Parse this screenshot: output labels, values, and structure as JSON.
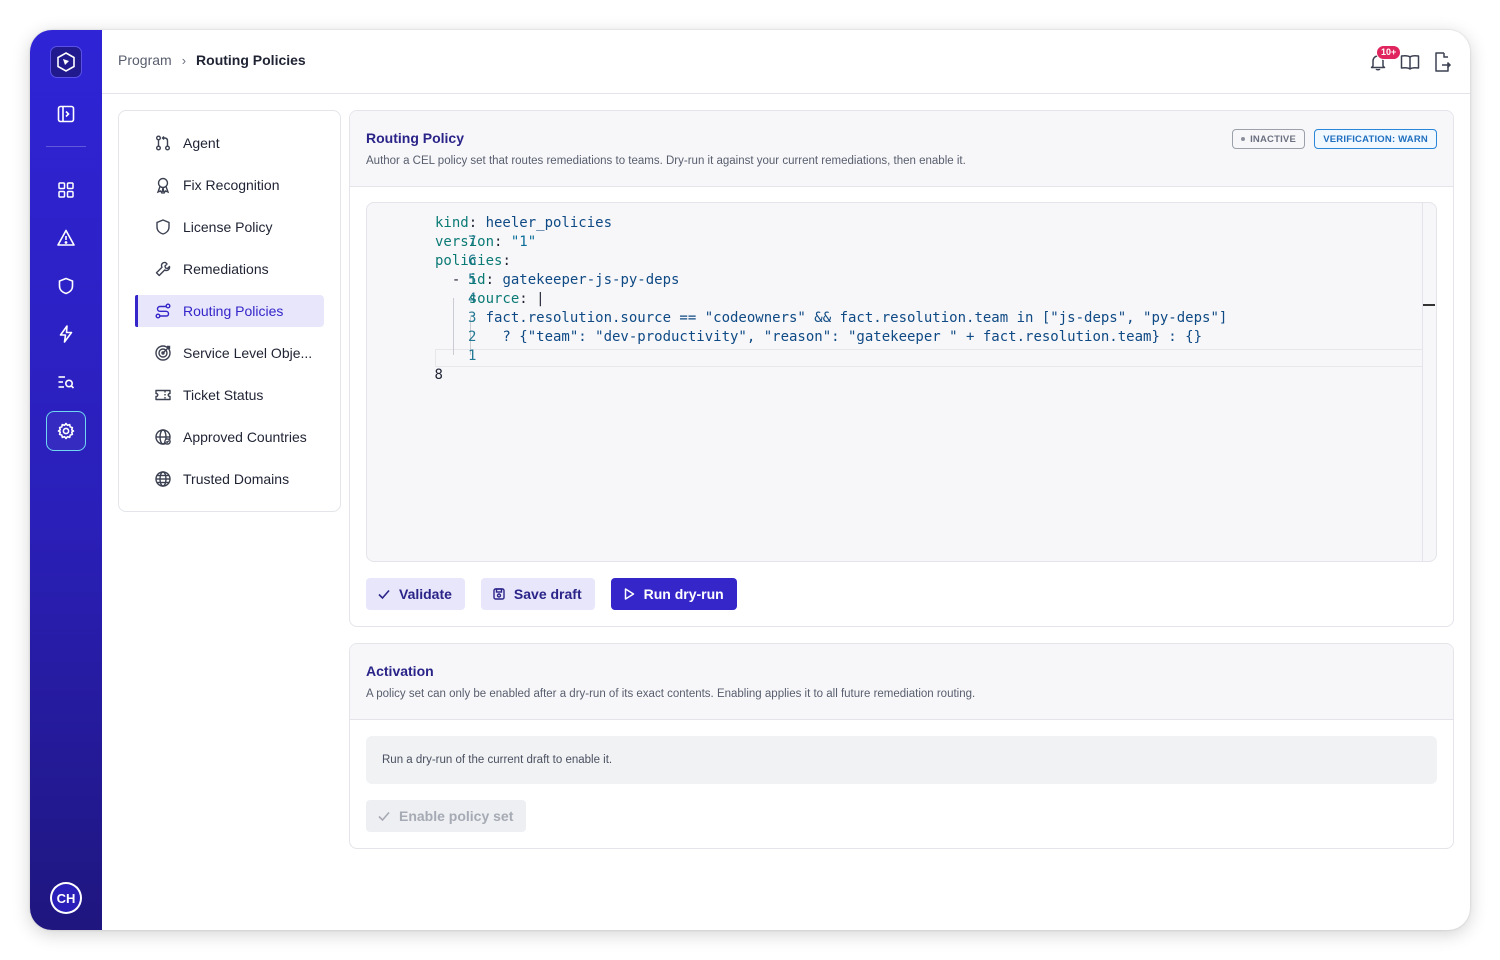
{
  "header": {
    "breadcrumb": [
      "Program",
      "Routing Policies"
    ],
    "notifications_badge": "10+"
  },
  "rail": {
    "items": [
      "collapse-sidebar",
      "dashboard",
      "alerts",
      "security",
      "automations",
      "search",
      "settings"
    ],
    "active": "settings",
    "user_initials": "CH"
  },
  "subnav": {
    "items": [
      {
        "label": "Agent",
        "icon": "git-pull-request-icon"
      },
      {
        "label": "Fix Recognition",
        "icon": "award-icon"
      },
      {
        "label": "License Policy",
        "icon": "shield-icon"
      },
      {
        "label": "Remediations",
        "icon": "wrench-icon"
      },
      {
        "label": "Routing Policies",
        "icon": "route-icon",
        "active": true
      },
      {
        "label": "Service Level Obje...",
        "icon": "target-icon"
      },
      {
        "label": "Ticket Status",
        "icon": "ticket-icon"
      },
      {
        "label": "Approved Countries",
        "icon": "globe-icon"
      },
      {
        "label": "Trusted Domains",
        "icon": "globe-icon"
      }
    ]
  },
  "policy_card": {
    "title": "Routing Policy",
    "description": "Author a CEL policy set that routes remediations to teams. Dry-run it against your current remediations, then enable it.",
    "status_badge": "INACTIVE",
    "verification_badge": "VERIFICATION: WARN",
    "editor": {
      "line_numbers": [
        "7",
        "6",
        "5",
        "4",
        "3",
        "2",
        "1",
        "8"
      ],
      "lines": [
        "kind: heeler_policies",
        "version: \"1\"",
        "policies:",
        "  - id: gatekeeper-js-py-deps",
        "    source: |",
        "      fact.resolution.source == \"codeowners\" && fact.resolution.team in [\"js-deps\", \"py-deps\"]",
        "        ? {\"team\": \"dev-productivity\", \"reason\": \"gatekeeper \" + fact.resolution.team} : {}",
        ""
      ]
    },
    "buttons": {
      "validate": "Validate",
      "save_draft": "Save draft",
      "run_dry_run": "Run dry-run"
    }
  },
  "activation_card": {
    "title": "Activation",
    "description": "A policy set can only be enabled after a dry-run of its exact contents. Enabling applies it to all future remediation routing.",
    "notice": "Run a dry-run of the current draft to enable it.",
    "enable_button": "Enable policy set"
  },
  "colors": {
    "accent": "#3426c9",
    "rail_top": "#2f24d6",
    "rail_bottom": "#1f167f",
    "badge": "#e0245e",
    "verification": "#2a86d8"
  }
}
